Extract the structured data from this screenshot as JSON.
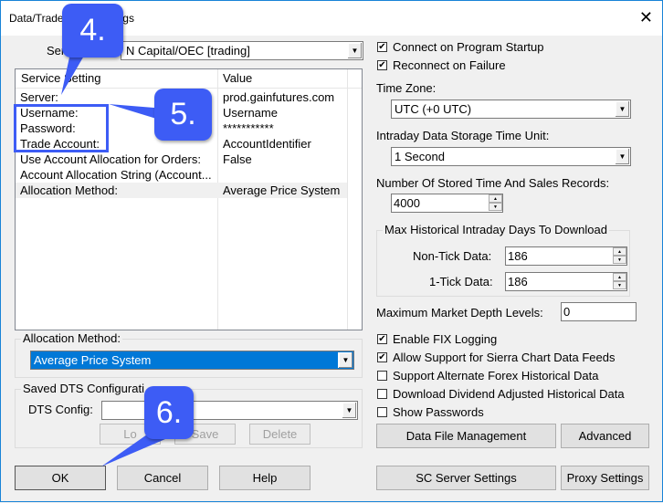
{
  "window": {
    "title": "Data/Trade Service Settings",
    "title_visible": "Data/Trade",
    "title_visible_end": "ngs"
  },
  "service": {
    "label": "Ser",
    "value": "N Capital/OEC    [trading]"
  },
  "settings_list": {
    "columns": [
      "Service Setting",
      "Value"
    ],
    "rows": [
      {
        "setting": "Server:",
        "value": "prod.gainfutures.com"
      },
      {
        "setting": "Username:",
        "value": "Username"
      },
      {
        "setting": "Password:",
        "value": "***********"
      },
      {
        "setting": "Trade Account:",
        "value": "AccountIdentifier"
      },
      {
        "setting": "Use Account Allocation for Orders:",
        "value": "False"
      },
      {
        "setting": "Account Allocation String (Account...",
        "value": ""
      },
      {
        "setting": "Allocation Method:",
        "value": "Average Price System",
        "highlighted": true
      }
    ]
  },
  "allocation_group": {
    "label": "Allocation Method:",
    "value": "Average Price System"
  },
  "dts_group": {
    "label": "Saved DTS Configurati",
    "config_label": "DTS Config:",
    "config_value": "",
    "load_label": "Lo",
    "save_label": "Save",
    "delete_label": "Delete"
  },
  "bottom_buttons": {
    "ok": "OK",
    "cancel": "Cancel",
    "help": "Help"
  },
  "right": {
    "connect_startup": {
      "label": "Connect on Program Startup",
      "checked": true
    },
    "reconnect_failure": {
      "label": "Reconnect on Failure",
      "checked": true
    },
    "time_zone_label": "Time Zone:",
    "time_zone_value": "UTC (+0 UTC)",
    "storage_unit_label": "Intraday Data Storage Time Unit:",
    "storage_unit_value": "1 Second",
    "records_label": "Number Of Stored Time And Sales Records:",
    "records_value": "4000",
    "max_hist_group": "Max Historical Intraday Days To Download",
    "non_tick_label": "Non-Tick Data:",
    "non_tick_value": "186",
    "one_tick_label": "1-Tick Data:",
    "one_tick_value": "186",
    "depth_label": "Maximum Market Depth Levels:",
    "depth_value": "0",
    "checks": [
      {
        "label": "Enable FIX Logging",
        "checked": true
      },
      {
        "label": "Allow Support for Sierra Chart Data Feeds",
        "checked": true
      },
      {
        "label": "Support Alternate Forex Historical Data",
        "checked": false
      },
      {
        "label": "Download Dividend Adjusted Historical Data",
        "checked": false
      },
      {
        "label": "Show Passwords",
        "checked": false
      }
    ],
    "data_file_mgmt": "Data File Management",
    "advanced": "Advanced",
    "sc_server": "SC Server Settings",
    "proxy": "Proxy Settings"
  },
  "callouts": {
    "c4": "4.",
    "c5": "5.",
    "c6": "6."
  },
  "colors": {
    "callout": "#3d5cf5",
    "selection": "#0078d7",
    "window_border": "#1883d7"
  }
}
